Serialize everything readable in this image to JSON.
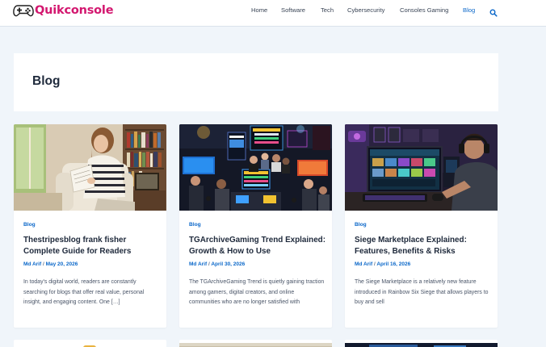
{
  "header": {
    "logo_text": "Quikconsole",
    "logo_icon": "gamepad-icon",
    "nav": [
      {
        "label": "Home",
        "active": false
      },
      {
        "label": "Software",
        "active": false
      },
      {
        "label": "Tech",
        "active": false
      },
      {
        "label": "Cybersecurity",
        "active": false
      },
      {
        "label": "Consoles Gaming",
        "active": false
      },
      {
        "label": "Blog",
        "active": true
      }
    ],
    "search_icon": "search-icon"
  },
  "page": {
    "title": "Blog"
  },
  "cards": [
    {
      "category": "Blog",
      "title": "Thestripesblog frank fisher Complete Guide for Readers",
      "author": "Md Arif",
      "date": "May 20, 2026",
      "excerpt": "In today's digital world, readers are constantly searching for blogs that offer real value, personal insight, and engaging content. One […]"
    },
    {
      "category": "Blog",
      "title": "TGArchiveGaming Trend Explained: Growth & How to Use",
      "author": "Md Arif",
      "date": "April 30, 2026",
      "excerpt": "The TGArchiveGaming Trend is quietly gaining traction among gamers, digital creators, and online communities who are no longer satisfied with"
    },
    {
      "category": "Blog",
      "title": "Siege Marketplace Explained: Features, Benefits & Risks",
      "author": "Md Arif",
      "date": "April 16, 2026",
      "excerpt": "The Siege Marketplace is a relatively new feature introduced in Rainbow Six Siege that allows players to buy and sell"
    }
  ],
  "colors": {
    "brand": "#d3176f",
    "accent": "#0a67c9",
    "background": "#f0f5fa"
  }
}
